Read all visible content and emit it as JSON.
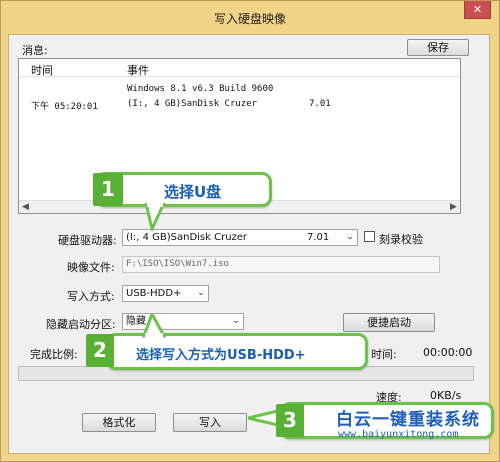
{
  "window": {
    "title": "写入硬盘映像",
    "close_glyph": "✕"
  },
  "messages": {
    "label": "消息:",
    "save_label": "保存"
  },
  "log": {
    "columns": [
      "时间",
      "事件"
    ],
    "rows": [
      {
        "time": "",
        "event": "Windows 8.1 v6.3 Build 9600",
        "extra": ""
      },
      {
        "time": "下午 05:20:01",
        "event": "(I:, 4 GB)SanDisk Cruzer",
        "extra": "7.01"
      }
    ]
  },
  "form": {
    "drive_label": "硬盘驱动器:",
    "drive_value": "(I:, 4 GB)SanDisk Cruzer",
    "drive_version": "7.01",
    "verify_label": "刻录校验",
    "verify_checked": false,
    "image_label": "映像文件:",
    "image_value": "F:\\ISO\\ISO\\Win7.iso",
    "method_label": "写入方式:",
    "method_value": "USB-HDD+",
    "hidden_label": "隐藏启动分区:",
    "hidden_value": "隐藏",
    "quick_boot_label": "便捷启动"
  },
  "status": {
    "progress_label": "完成比例:",
    "time_label": "时间:",
    "time_value": "00:00:00",
    "speed_label": "速度:",
    "speed_value": "0KB/s",
    "progress_fraction": 0
  },
  "actions": {
    "format_label": "格式化",
    "write_label": "写入"
  },
  "annotations": [
    {
      "number": "1",
      "text": "选择U盘"
    },
    {
      "number": "2",
      "text": "选择写入方式为USB-HDD+"
    },
    {
      "number": "3",
      "text": ""
    }
  ],
  "brand": {
    "name": "白云一键重装系统",
    "url": "www.baiyunxitong.com"
  },
  "colors": {
    "frame": "#f2d489",
    "callout_border": "#6cc24a",
    "badge": "#58b134",
    "brand_blue": "#1f5fb8"
  },
  "icons": {
    "dropdown": "chevron-down-icon",
    "scroll_left": "arrow-left-icon",
    "scroll_right": "arrow-right-icon"
  }
}
